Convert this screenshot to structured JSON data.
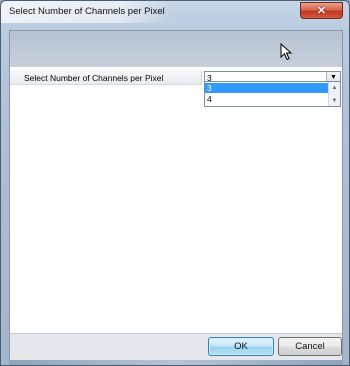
{
  "window": {
    "title": "Select Number of Channels per Pixel",
    "close_glyph": "✕"
  },
  "form": {
    "row_label": "Select Number of Channels per Pixel",
    "combo_value": "3",
    "options": [
      "3",
      "4"
    ],
    "selected_option_index": 0
  },
  "buttons": {
    "ok_label": "OK",
    "cancel_label": "Cancel"
  },
  "icons": {
    "dropdown_arrow": "▼",
    "scroll_up": "▲",
    "scroll_down": "▼"
  },
  "colors": {
    "selection": "#3399ff",
    "close_button": "#c0391f"
  }
}
